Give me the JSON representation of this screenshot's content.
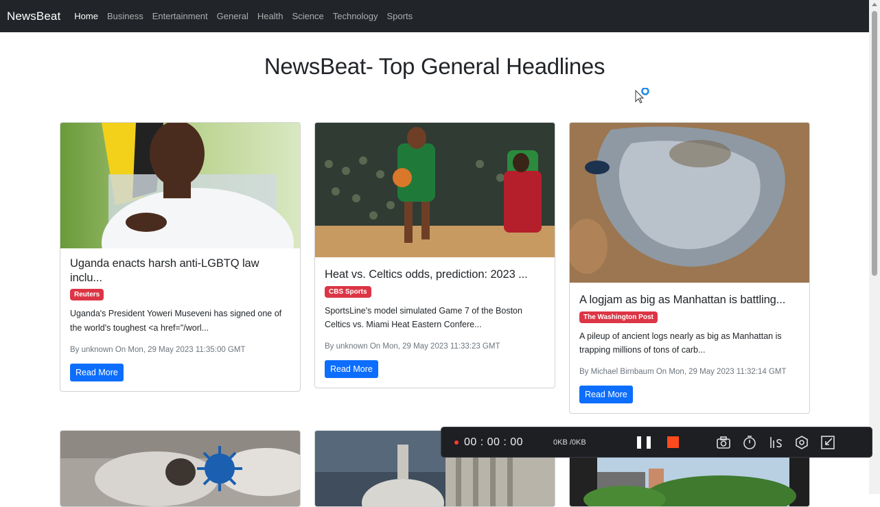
{
  "navbar": {
    "brand": "NewsBeat",
    "links": [
      "Home",
      "Business",
      "Entertainment",
      "General",
      "Health",
      "Science",
      "Technology",
      "Sports"
    ]
  },
  "page": {
    "title": "NewsBeat- Top General Headlines"
  },
  "cards": [
    {
      "title": "Uganda enacts harsh anti-LGBTQ law inclu...",
      "source": "Reuters",
      "description": "Uganda's President Yoweri Museveni has signed one of the world's toughest <a href=\"/worl...",
      "meta": "By unknown On Mon, 29 May 2023 11:35:00 GMT",
      "button": "Read More"
    },
    {
      "title": "Heat vs. Celtics odds, prediction: 2023 ...",
      "source": "CBS Sports",
      "description": "SportsLine's model simulated Game 7 of the Boston Celtics vs. Miami Heat Eastern Confere...",
      "meta": "By unknown On Mon, 29 May 2023 11:33:23 GMT",
      "button": "Read More"
    },
    {
      "title": "A logjam as big as Manhattan is battling...",
      "source": "The Washington Post",
      "description": "A pileup of ancient logs nearly as big as Manhattan is trapping millions of tons of carb...",
      "meta": "By Michael Birnbaum On Mon, 29 May 2023 11:32:14 GMT",
      "button": "Read More"
    }
  ],
  "recorder": {
    "time": "00 : 00 : 00",
    "size": "0KB /0KB"
  }
}
